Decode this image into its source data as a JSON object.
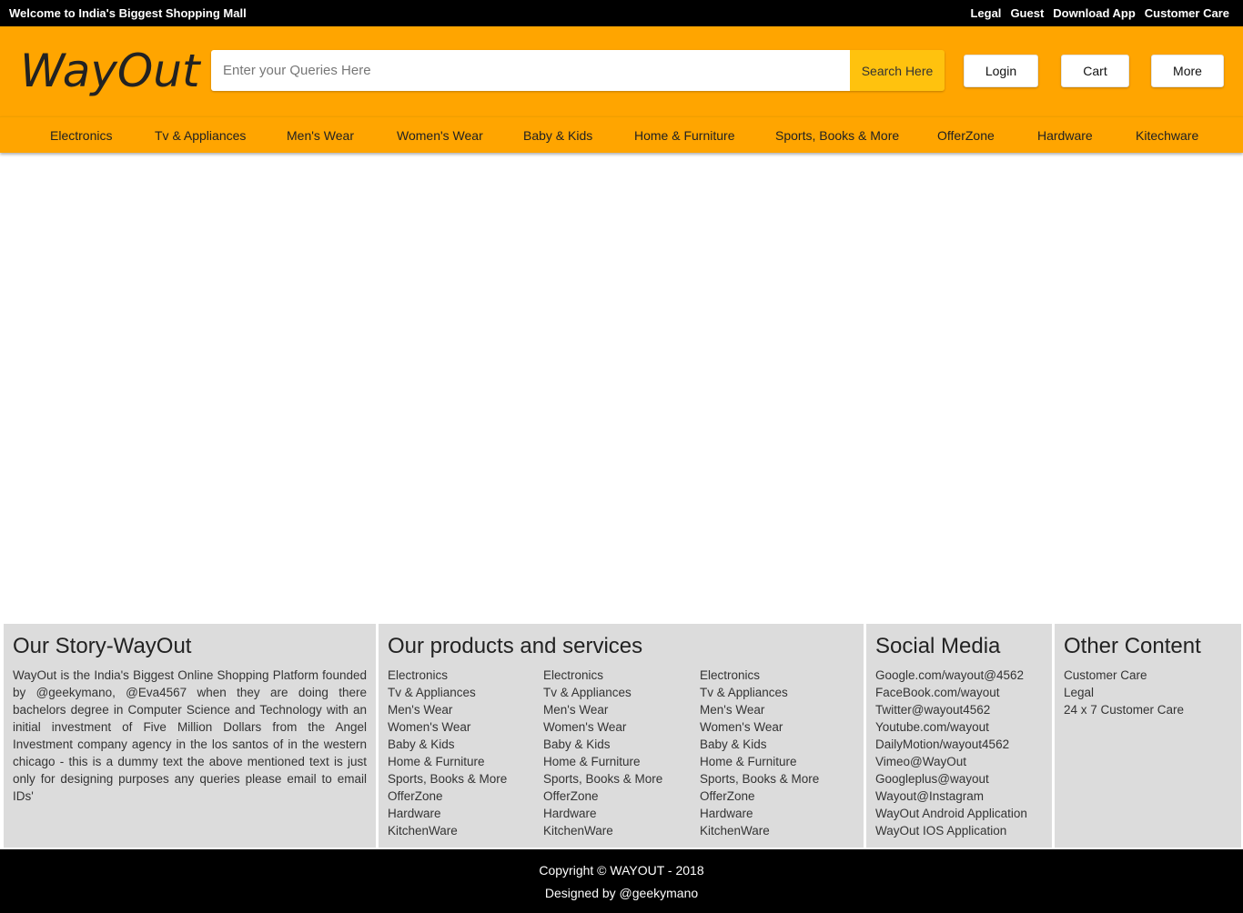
{
  "topbar": {
    "welcome": "Welcome to India's Biggest Shopping Mall",
    "links": [
      "Legal",
      "Guest",
      "Download App",
      "Customer Care"
    ]
  },
  "header": {
    "logo": "WayOut",
    "search_placeholder": "Enter your Queries Here",
    "search_button": "Search Here",
    "login": "Login",
    "cart": "Cart",
    "more": "More"
  },
  "nav": [
    "Electronics",
    "Tv & Appliances",
    "Men's Wear",
    "Women's Wear",
    "Baby & Kids",
    "Home & Furniture",
    "Sports, Books & More",
    "OfferZone",
    "Hardware",
    "Kitechware"
  ],
  "footer": {
    "story_title": "Our Story-WayOut",
    "story_text": "WayOut is the India's Biggest Online Shopping Platform founded by @geekymano, @Eva4567 when they are doing there bachelors degree in Computer Science and Technology with an initial investment of Five Million Dollars from the Angel Investment company agency in the los santos of in the western chicago - this is a dummy text the above mentioned text is just only for designing purposes any queries please email to email IDs'",
    "products_title": "Our products and services",
    "products": [
      "Electronics",
      "Tv & Appliances",
      "Men's Wear",
      "Women's Wear",
      "Baby & Kids",
      "Home & Furniture",
      "Sports, Books & More",
      "OfferZone",
      "Hardware",
      "KitchenWare"
    ],
    "social_title": "Social Media",
    "social": [
      "Google.com/wayout@4562",
      "FaceBook.com/wayout",
      "Twitter@wayout4562",
      "Youtube.com/wayout",
      "DailyMotion/wayout4562",
      "Vimeo@WayOut",
      "Googleplus@wayout",
      "Wayout@Instagram",
      "WayOut Android Application",
      "WayOut IOS Application"
    ],
    "other_title": "Other Content",
    "other": [
      "Customer Care",
      "Legal",
      "24 x 7 Customer Care"
    ]
  },
  "bottom": {
    "copyright": "Copyright © WAYOUT - 2018",
    "designed": "Designed by @geekymano"
  }
}
